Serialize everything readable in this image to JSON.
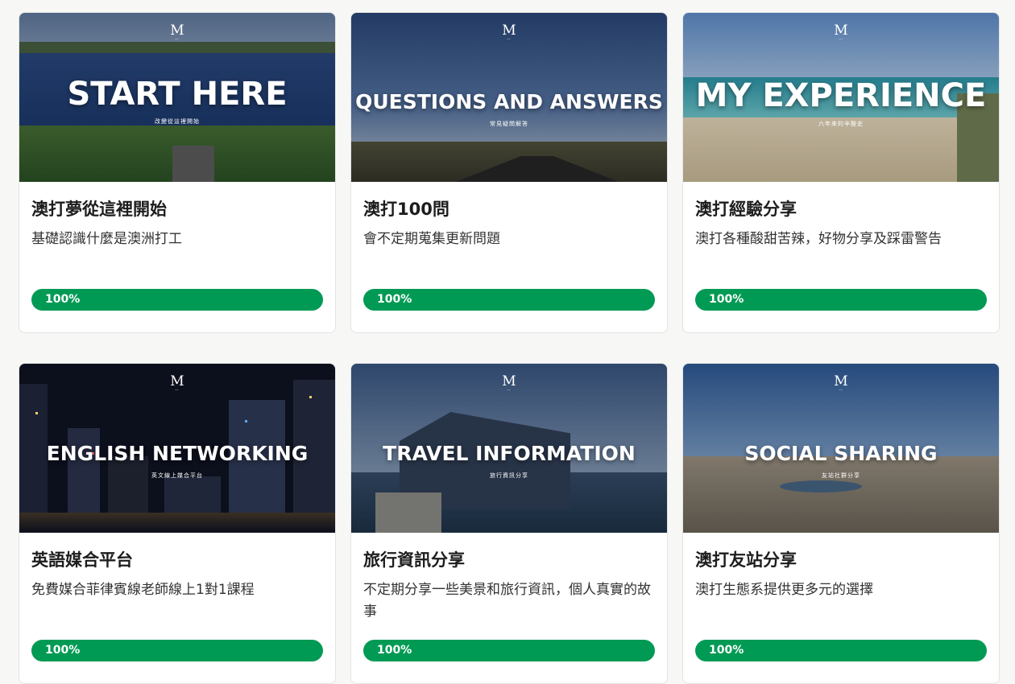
{
  "cards": [
    {
      "banner_title": "START HERE",
      "banner_subtitle": "改變從這裡開始",
      "title": "澳打夢從這裡開始",
      "description": "基礎認識什麼是澳洲打工",
      "progress_label": "100%",
      "progress": 1.0
    },
    {
      "banner_title": "QUESTIONS AND ANSWERS",
      "banner_subtitle": "常見疑問解答",
      "title": "澳打100問",
      "description": "會不定期蒐集更新問題",
      "progress_label": "100%",
      "progress": 1.0
    },
    {
      "banner_title": "MY EXPERIENCE",
      "banner_subtitle": "六年來的辛酸史",
      "title": "澳打經驗分享",
      "description": "澳打各種酸甜苦辣，好物分享及踩雷警告",
      "progress_label": "100%",
      "progress": 1.0
    },
    {
      "banner_title": "ENGLISH  NETWORKING",
      "banner_subtitle": "英文線上媒合平台",
      "title": "英語媒合平台",
      "description": "免費媒合菲律賓線老師線上1對1課程",
      "progress_label": "100%",
      "progress": 1.0
    },
    {
      "banner_title": "TRAVEL INFORMATION",
      "banner_subtitle": "旅行資訊分享",
      "title": "旅行資訊分享",
      "description": "不定期分享一些美景和旅行資訊，個人真實的故事",
      "progress_label": "100%",
      "progress": 1.0
    },
    {
      "banner_title": "SOCIAL SHARING",
      "banner_subtitle": "友站社群分享",
      "title": "澳打友站分享",
      "description": "澳打生態系提供更多元的選擇",
      "progress_label": "100%",
      "progress": 1.0
    }
  ],
  "logo_text": "M",
  "colors": {
    "progress": "#009a54",
    "card_bg": "#ffffff",
    "page_bg": "#f7f7f5"
  }
}
